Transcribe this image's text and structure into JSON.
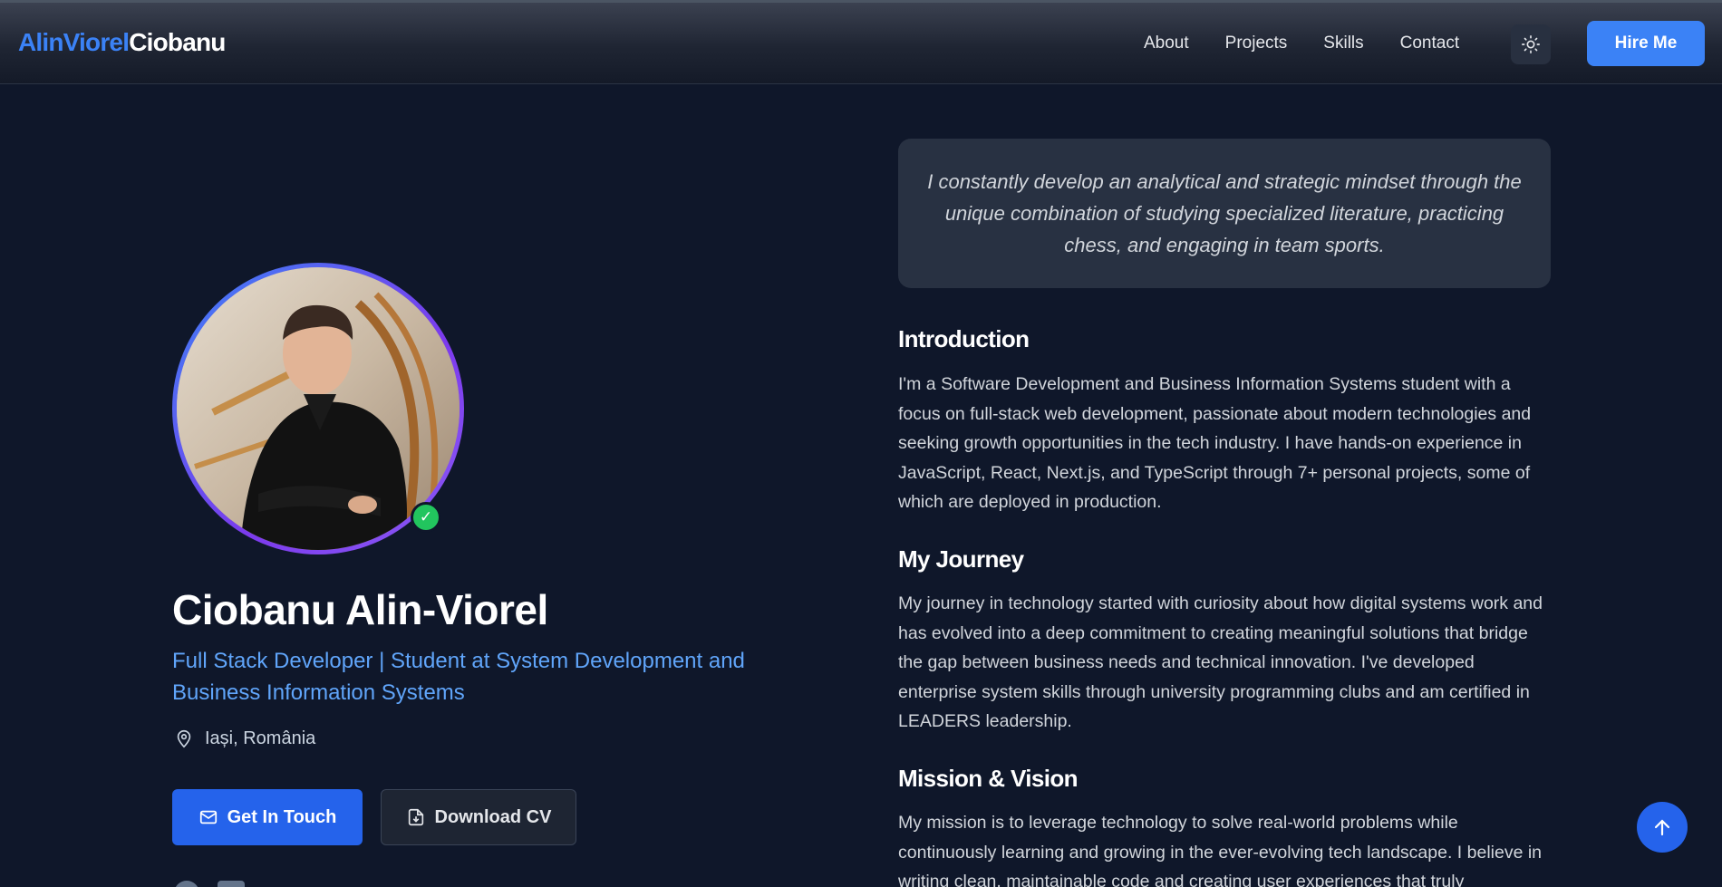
{
  "header": {
    "logo_first": "AlinViorel",
    "logo_last": "Ciobanu",
    "nav": [
      "About",
      "Projects",
      "Skills",
      "Contact"
    ],
    "theme_icon": "sun-icon",
    "hire_label": "Hire Me"
  },
  "profile": {
    "name": "Ciobanu Alin-Viorel",
    "subtitle": "Full Stack Developer | Student at System Development and Business Information Systems",
    "location": "Iași, România",
    "touch_label": "Get In Touch",
    "cv_label": "Download CV",
    "verified_mark": "✓"
  },
  "about": {
    "quote": "I constantly develop an analytical and strategic mindset through the unique combination of studying specialized literature, practicing chess, and engaging in team sports.",
    "intro_title": "Introduction",
    "intro_text": "I'm a Software Development and Business Information Systems student with a focus on full-stack web development, passionate about modern technologies and seeking growth opportunities in the tech industry. I have hands-on experience in JavaScript, React, Next.js, and TypeScript through 7+ personal projects, some of which are deployed in production.",
    "journey_title": "My Journey",
    "journey_text": "My journey in technology started with curiosity about how digital systems work and has evolved into a deep commitment to creating meaningful solutions that bridge the gap between business needs and technical innovation. I've developed enterprise system skills through university programming clubs and am certified in LEADERS leadership.",
    "mission_title": "Mission & Vision",
    "mission_text": "My mission is to leverage technology to solve real-world problems while continuously learning and growing in the ever-evolving tech landscape. I believe in writing clean, maintainable code and creating user experiences that truly"
  },
  "colors": {
    "background": "#0f172a",
    "accent": "#3b82f6",
    "subtitle": "#60a5fa",
    "verified": "#22c55e"
  }
}
